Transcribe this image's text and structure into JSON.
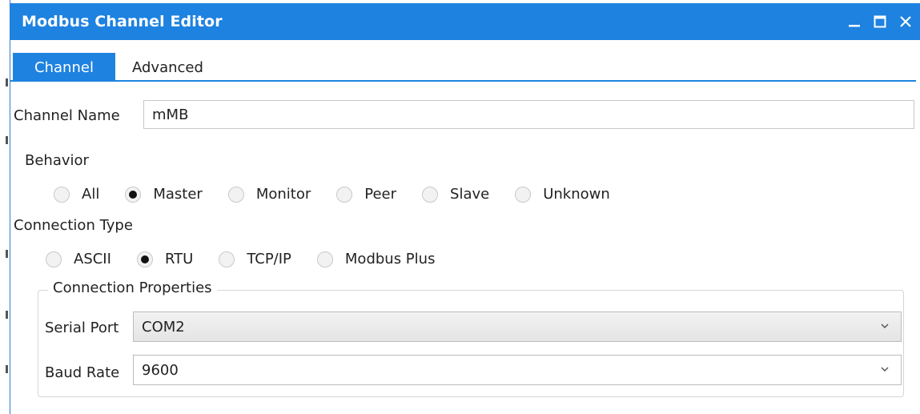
{
  "window": {
    "title": "Modbus Channel Editor",
    "controls": [
      "minimize-icon",
      "maximize-icon",
      "close-icon"
    ]
  },
  "tabs": [
    {
      "label": "Channel",
      "active": true
    },
    {
      "label": "Advanced",
      "active": false
    }
  ],
  "channel_name": {
    "label": "Channel Name",
    "value": "mMB"
  },
  "behavior": {
    "label": "Behavior",
    "options": [
      "All",
      "Master",
      "Monitor",
      "Peer",
      "Slave",
      "Unknown"
    ],
    "selected": "Master"
  },
  "connection_type": {
    "label": "Connection Type",
    "options": [
      "ASCII",
      "RTU",
      "TCP/IP",
      "Modbus Plus"
    ],
    "selected": "RTU"
  },
  "connection_properties": {
    "legend": "Connection Properties",
    "serial_port": {
      "label": "Serial Port",
      "value": "COM2"
    },
    "baud_rate": {
      "label": "Baud Rate",
      "value": "9600"
    }
  },
  "colors": {
    "accent": "#1e82e0",
    "title_text": "#ffffff"
  }
}
